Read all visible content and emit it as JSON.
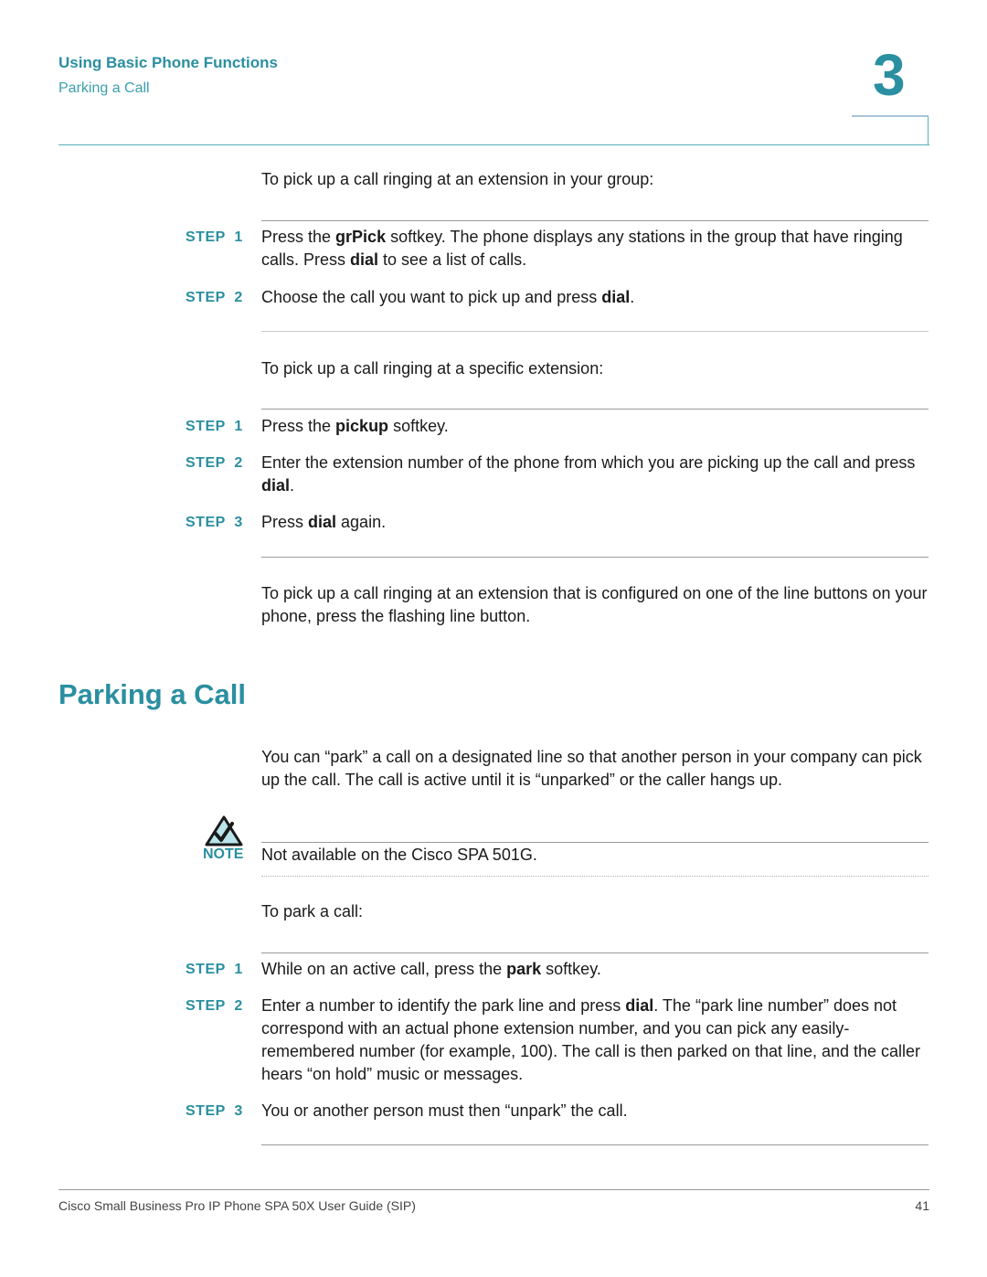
{
  "header": {
    "chapter_title": "Using Basic Phone Functions",
    "section_subtitle": "Parking a Call",
    "chapter_number": "3"
  },
  "group_pickup": {
    "intro": "To pick up a call ringing at an extension in your group:",
    "steps": [
      {
        "label": "STEP  1",
        "parts": [
          "Press the ",
          "grPick",
          " softkey. The phone displays any stations in the group that have ringing calls. Press ",
          "dial",
          " to see a list of calls."
        ]
      },
      {
        "label": "STEP  2",
        "parts": [
          "Choose the call you want to pick up and press ",
          "dial",
          "."
        ]
      }
    ]
  },
  "specific_pickup": {
    "intro": "To pick up a call ringing at a specific extension:",
    "steps": [
      {
        "label": "STEP  1",
        "parts": [
          "Press the ",
          "pickup",
          " softkey."
        ]
      },
      {
        "label": "STEP  2",
        "parts": [
          "Enter the extension number of the phone from which you are picking up the call and press ",
          "dial",
          "."
        ]
      },
      {
        "label": "STEP  3",
        "parts": [
          "Press ",
          "dial",
          " again."
        ]
      }
    ]
  },
  "line_button_paragraph": "To pick up a call ringing at an extension that is configured on one of the line buttons on your phone, press the flashing line button.",
  "parking": {
    "title": "Parking a Call",
    "intro": "You can “park” a call on a designated line so that another person in your company can pick up the call. The call is active until it is “unparked” or the caller hangs up.",
    "note_label": "NOTE",
    "note_text": "Not available on the Cisco SPA 501G.",
    "park_intro": "To park a call:",
    "steps": [
      {
        "label": "STEP  1",
        "parts": [
          "While on an active call, press the ",
          "park",
          " softkey."
        ]
      },
      {
        "label": "STEP  2",
        "parts": [
          "Enter a number to identify the park line and press ",
          "dial",
          ". The “park line number” does not correspond with an actual phone extension number, and you can pick any easily-remembered number (for example, 100). The call is then parked on that line, and the caller hears “on hold” music or messages."
        ]
      },
      {
        "label": "STEP  3",
        "parts": [
          "You or another person must then “unpark” the call."
        ]
      }
    ]
  },
  "footer": {
    "doc_title": "Cisco Small Business Pro IP Phone SPA 50X User Guide (SIP)",
    "page_number": "41"
  },
  "colors": {
    "accent": "#2a8fa0",
    "note_icon_fill": "#b9e4ea"
  }
}
